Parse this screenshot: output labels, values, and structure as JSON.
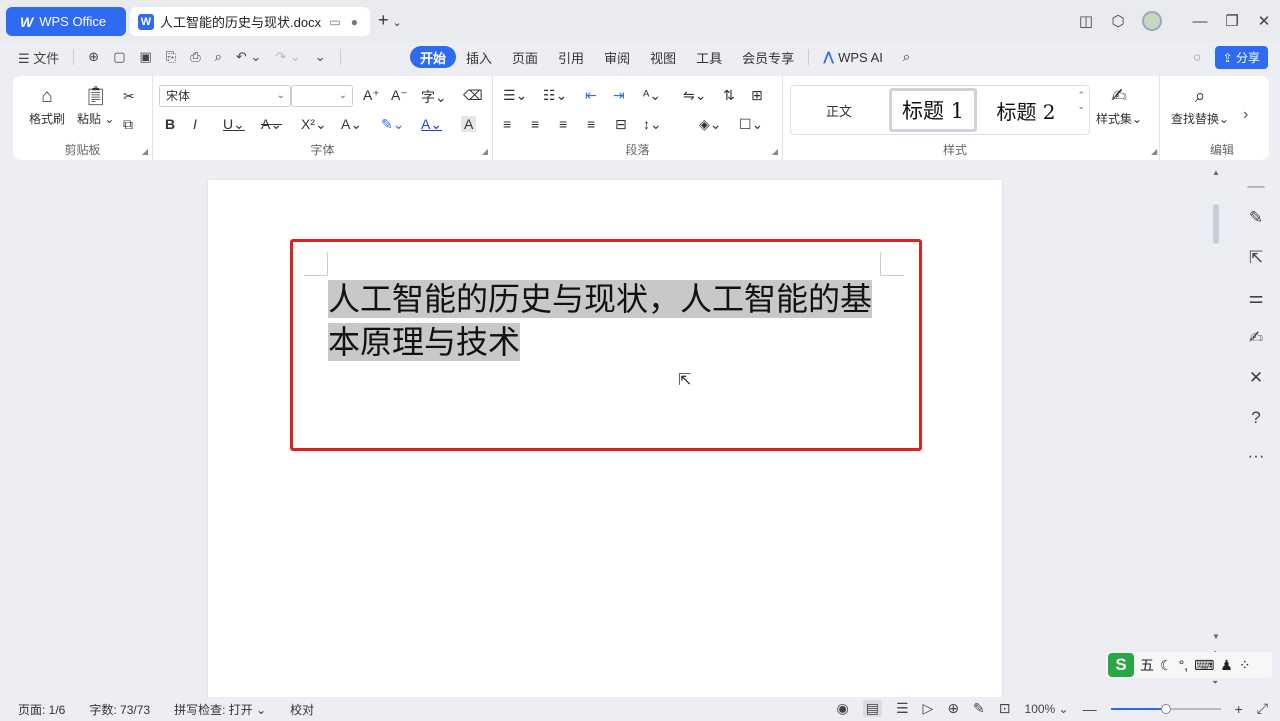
{
  "titlebar": {
    "app_tab": "WPS Office",
    "doc_tab": "人工智能的历史与现状.docx"
  },
  "menubar": {
    "file_label": "文件",
    "tabs": [
      "开始",
      "插入",
      "页面",
      "引用",
      "审阅",
      "视图",
      "工具",
      "会员专享"
    ],
    "active_tab": "开始",
    "wps_ai": "WPS AI",
    "share": "分享"
  },
  "ribbon": {
    "clipboard": {
      "format_painter": "格式刷",
      "paste": "粘贴",
      "group_label": "剪贴板"
    },
    "font": {
      "family": "宋体",
      "size": "",
      "group_label": "字体"
    },
    "paragraph": {
      "group_label": "段落"
    },
    "styles": {
      "normal": "正文",
      "heading1": "标题 1",
      "heading2": "标题 2",
      "style_set": "样式集",
      "group_label": "样式"
    },
    "edit": {
      "find_replace": "查找替换",
      "group_label": "编辑"
    }
  },
  "document": {
    "line1": "人工智能的历史与现状，人工智能的基",
    "line2": "本原理与技术",
    "highlight_color": "#c8c8c8",
    "annotation_color": "#e02020"
  },
  "ime": {
    "mode": "五"
  },
  "statusbar": {
    "page": "页面: 1/6",
    "word_count": "字数: 73/73",
    "spell_check": "拼写检查: 打开",
    "proofread": "校对",
    "zoom": "100%",
    "zoom_level": 0.5
  },
  "colors": {
    "accent": "#2f6bf0"
  }
}
